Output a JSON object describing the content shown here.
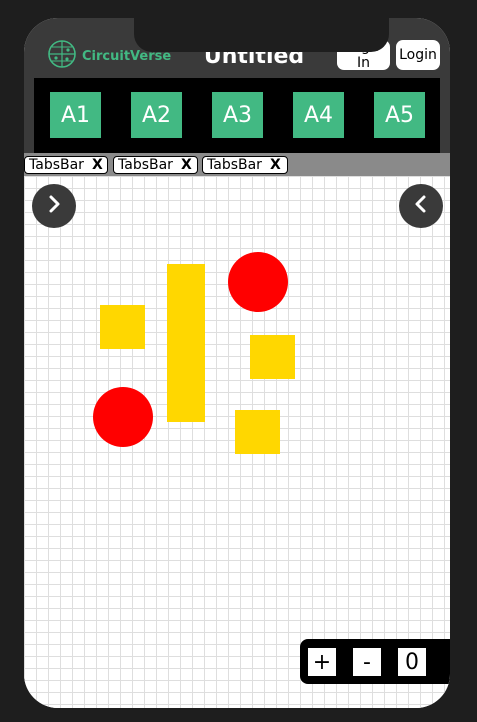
{
  "header": {
    "logo_text": "CircuitVerse",
    "title": "Untitled",
    "sign_in_label": "Sign In",
    "login_label": "Login",
    "logo_icon": "circuit-globe-icon",
    "accent_color": "#42b983"
  },
  "toolbar": {
    "buttons": [
      {
        "label": "A1"
      },
      {
        "label": "A2"
      },
      {
        "label": "A3"
      },
      {
        "label": "A4"
      },
      {
        "label": "A5"
      }
    ]
  },
  "tabs": [
    {
      "label": "TabsBar",
      "close": "X"
    },
    {
      "label": "TabsBar",
      "close": "X"
    },
    {
      "label": "TabsBar",
      "close": "X"
    }
  ],
  "canvas": {
    "left_nav_icon": "chevron-right-icon",
    "right_nav_icon": "chevron-left-icon",
    "shape_colors": {
      "rect": "#ffd700",
      "circle": "#ff0000"
    }
  },
  "zoom": {
    "plus_label": "+",
    "minus_label": "-",
    "value": "0"
  }
}
